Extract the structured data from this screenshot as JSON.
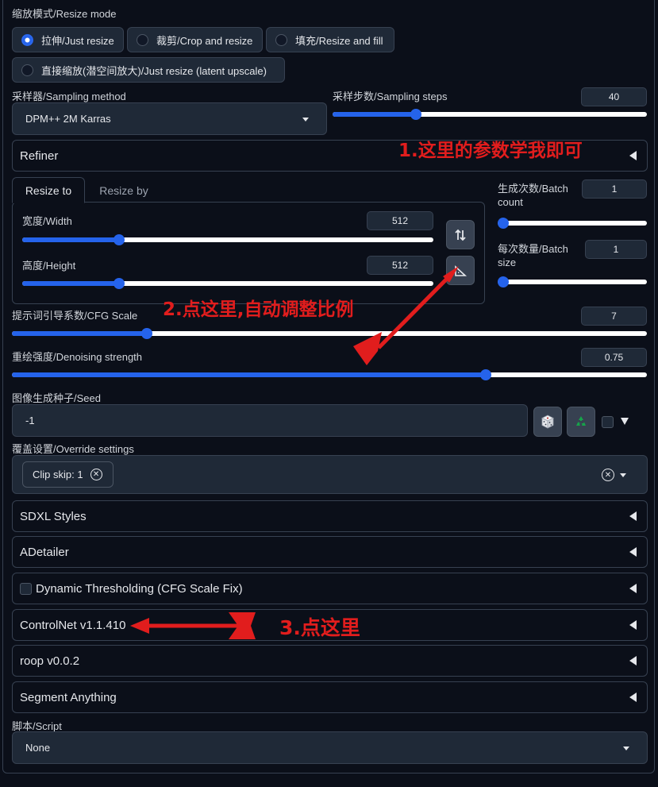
{
  "resize_mode": {
    "label": "缩放模式/Resize mode",
    "options": [
      "拉伸/Just resize",
      "裁剪/Crop and resize",
      "填充/Resize and fill",
      "直接缩放(潜空间放大)/Just resize (latent upscale)"
    ],
    "selected_index": 0
  },
  "sampler": {
    "label": "采样器/Sampling method",
    "value": "DPM++ 2M Karras"
  },
  "steps": {
    "label": "采样步数/Sampling steps",
    "value": "40",
    "level": 0.2564
  },
  "refiner": {
    "title": "Refiner"
  },
  "size_tabs": [
    "Resize to",
    "Resize by"
  ],
  "width": {
    "label": "宽度/Width",
    "value": "512",
    "level": 0.2284
  },
  "height": {
    "label": "高度/Height",
    "value": "512",
    "level": 0.2284
  },
  "batch_count": {
    "label_line1": "生成次数/Batch",
    "label_line2": "count",
    "value": "1",
    "level": 0.0
  },
  "batch_size": {
    "label_line1": "每次数量/Batch",
    "label_line2": "size",
    "value": "1",
    "level": 0.0
  },
  "cfg": {
    "label": "提示词引导系数/CFG Scale",
    "value": "7",
    "level": 0.2069
  },
  "denoise": {
    "label": "重绘强度/Denoising strength",
    "value": "0.75",
    "level": 0.75
  },
  "seed": {
    "label": "图像生成种子/Seed",
    "value": "-1"
  },
  "override": {
    "label": "覆盖设置/Override settings",
    "chip": "Clip skip: 1"
  },
  "accordions": [
    "SDXL Styles",
    "ADetailer",
    "Dynamic Thresholding (CFG Scale Fix)",
    "ControlNet v1.1.410",
    "roop v0.0.2",
    "Segment Anything"
  ],
  "script": {
    "label": "脚本/Script",
    "value": "None"
  },
  "annotations": {
    "a1": "1.这里的参数学我即可",
    "a2": "2.点这里,自动调整比例",
    "a3": "3.点这里"
  },
  "colors": {
    "accent": "#2563eb",
    "annotation": "#e11d1d",
    "background": "#0b0f19",
    "panel": "#1f2937"
  }
}
